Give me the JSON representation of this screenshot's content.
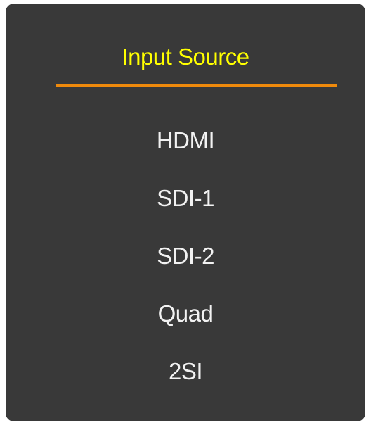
{
  "menu": {
    "title": "Input Source",
    "accent_color": "#ef8a0c",
    "title_color": "#ffff00",
    "background_color": "#393939",
    "items": [
      {
        "label": "HDMI"
      },
      {
        "label": "SDI-1"
      },
      {
        "label": "SDI-2"
      },
      {
        "label": "Quad"
      },
      {
        "label": "2SI"
      }
    ]
  }
}
